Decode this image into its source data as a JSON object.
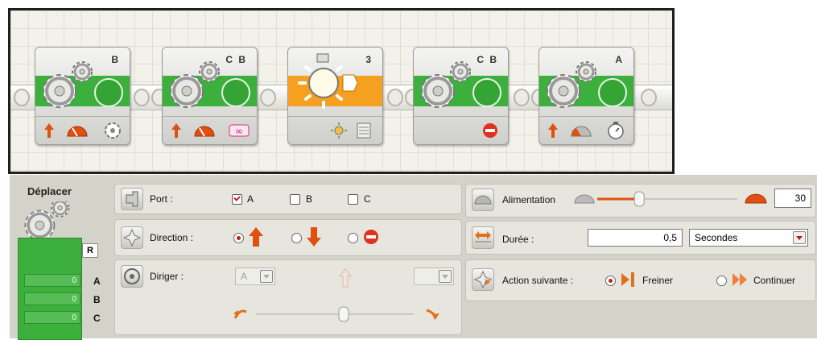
{
  "program": {
    "blocks": [
      {
        "type": "move",
        "port": "B",
        "icons": [
          "direction-up-icon",
          "power-gauge-icon",
          "rotation-icon"
        ]
      },
      {
        "type": "move",
        "port": "C B",
        "icons": [
          "direction-up-icon",
          "power-gauge-icon",
          "unlimited-icon"
        ]
      },
      {
        "type": "light-sensor",
        "port": "3",
        "icons": [
          "light-icon",
          "generate-light-icon",
          "sensor-list-icon"
        ]
      },
      {
        "type": "move",
        "port": "C B",
        "icons": [
          "stop-icon"
        ]
      },
      {
        "type": "move",
        "port": "A",
        "icons": [
          "direction-up-icon",
          "power-gauge-icon",
          "timer-icon"
        ]
      }
    ]
  },
  "panel": {
    "title": "Déplacer",
    "preview": {
      "selected": "R",
      "rows": [
        {
          "value": "0",
          "label": "A"
        },
        {
          "value": "0",
          "label": "B"
        },
        {
          "value": "0",
          "label": "C"
        }
      ]
    },
    "port": {
      "label": "Port :",
      "options": [
        {
          "label": "A",
          "checked": true
        },
        {
          "label": "B",
          "checked": false
        },
        {
          "label": "C",
          "checked": false
        }
      ]
    },
    "direction": {
      "label": "Direction :",
      "selected": "up"
    },
    "steering": {
      "label": "Diriger :",
      "left_port": "A",
      "right_port": ""
    },
    "power": {
      "label": "Alimentation",
      "value": "30",
      "level": 30
    },
    "duration": {
      "label": "Durée :",
      "value": "0,5",
      "unit": "Secondes"
    },
    "next_action": {
      "label": "Action suivante :",
      "options": [
        {
          "label": "Freiner",
          "selected": true
        },
        {
          "label": "Continuer",
          "selected": false
        }
      ]
    }
  },
  "colors": {
    "move_block": "#3caf3c",
    "sensor_block": "#f5a020",
    "accent": "#e04010",
    "panel": "#d3d3c9"
  }
}
